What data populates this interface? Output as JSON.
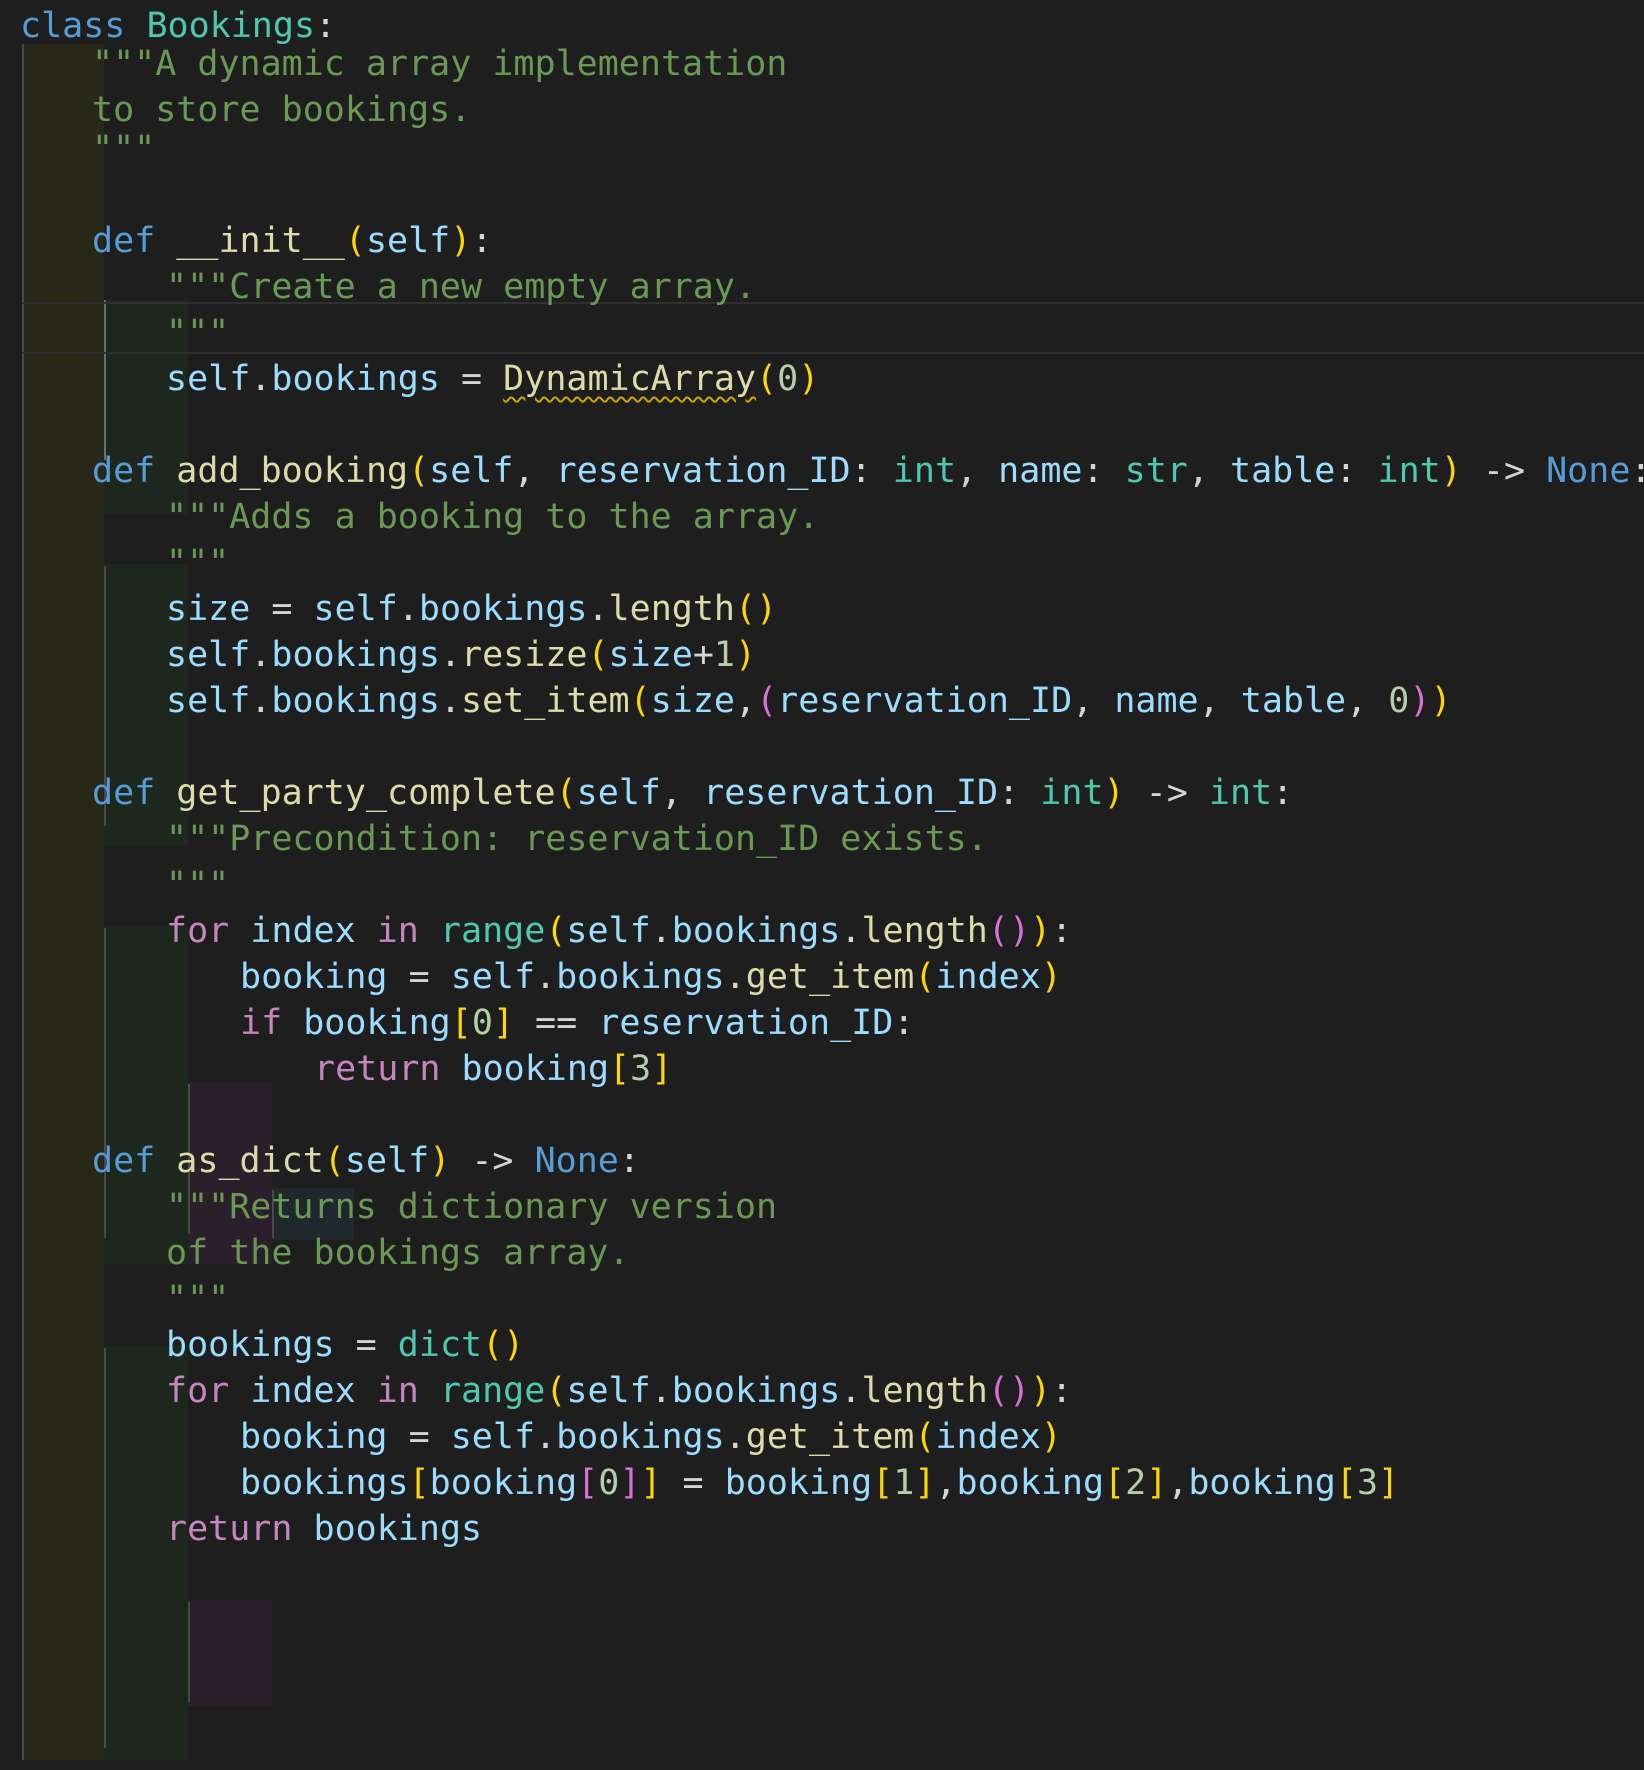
{
  "editor": {
    "language": "python",
    "colors": {
      "background": "#1e1e1e",
      "keyword": "#569cd6",
      "control": "#c586c0",
      "class_name": "#4ec9b0",
      "function": "#dcdcaa",
      "variable": "#9cdcfe",
      "string": "#6a9955",
      "number": "#b5cea8",
      "bracket_gold": "#ffd700",
      "bracket_purple": "#da70d6",
      "bracket_blue": "#179fff",
      "default": "#d4d4d4",
      "warning_squiggle": "#cca700"
    },
    "lines": [
      [
        [
          "class",
          "kw"
        ],
        [
          " ",
          "d"
        ],
        [
          "Bookings",
          "cls"
        ],
        [
          ":",
          "d"
        ]
      ],
      [
        [
          "\"\"\"A dynamic array implementation",
          "str"
        ]
      ],
      [
        [
          "to store bookings.",
          "str"
        ]
      ],
      [
        [
          "\"\"\"",
          "str"
        ]
      ],
      [],
      [
        [
          "def",
          "kw"
        ],
        [
          " ",
          "d"
        ],
        [
          "__init__",
          "fn"
        ],
        [
          "(",
          "b1"
        ],
        [
          "self",
          "var"
        ],
        [
          ")",
          "b1"
        ],
        [
          ":",
          "d"
        ]
      ],
      [
        [
          "\"\"\"Create a new empty array.",
          "str"
        ]
      ],
      [
        [
          "\"\"\"",
          "str"
        ]
      ],
      [
        [
          "self",
          "var"
        ],
        [
          ".",
          "d"
        ],
        [
          "bookings",
          "var"
        ],
        [
          " = ",
          "d"
        ],
        [
          "DynamicArray",
          "fnwarn"
        ],
        [
          "(",
          "b1"
        ],
        [
          "0",
          "num"
        ],
        [
          ")",
          "b1"
        ]
      ],
      [],
      [
        [
          "def",
          "kw"
        ],
        [
          " ",
          "d"
        ],
        [
          "add_booking",
          "fn"
        ],
        [
          "(",
          "b1"
        ],
        [
          "self",
          "var"
        ],
        [
          ", ",
          "d"
        ],
        [
          "reservation_ID",
          "var"
        ],
        [
          ": ",
          "d"
        ],
        [
          "int",
          "cls"
        ],
        [
          ", ",
          "d"
        ],
        [
          "name",
          "var"
        ],
        [
          ": ",
          "d"
        ],
        [
          "str",
          "cls"
        ],
        [
          ", ",
          "d"
        ],
        [
          "table",
          "var"
        ],
        [
          ": ",
          "d"
        ],
        [
          "int",
          "cls"
        ],
        [
          ")",
          "b1"
        ],
        [
          " -> ",
          "d"
        ],
        [
          "None",
          "kw"
        ],
        [
          ":",
          "d"
        ]
      ],
      [
        [
          "\"\"\"Adds a booking to the array.",
          "str"
        ]
      ],
      [
        [
          "\"\"\"",
          "str"
        ]
      ],
      [
        [
          "size",
          "var"
        ],
        [
          " = ",
          "d"
        ],
        [
          "self",
          "var"
        ],
        [
          ".",
          "d"
        ],
        [
          "bookings",
          "var"
        ],
        [
          ".",
          "d"
        ],
        [
          "length",
          "fn"
        ],
        [
          "()",
          "b1"
        ]
      ],
      [
        [
          "self",
          "var"
        ],
        [
          ".",
          "d"
        ],
        [
          "bookings",
          "var"
        ],
        [
          ".",
          "d"
        ],
        [
          "resize",
          "fn"
        ],
        [
          "(",
          "b1"
        ],
        [
          "size",
          "var"
        ],
        [
          "+",
          "d"
        ],
        [
          "1",
          "num"
        ],
        [
          ")",
          "b1"
        ]
      ],
      [
        [
          "self",
          "var"
        ],
        [
          ".",
          "d"
        ],
        [
          "bookings",
          "var"
        ],
        [
          ".",
          "d"
        ],
        [
          "set_item",
          "fn"
        ],
        [
          "(",
          "b1"
        ],
        [
          "size",
          "var"
        ],
        [
          ",",
          "d"
        ],
        [
          "(",
          "b2"
        ],
        [
          "reservation_ID",
          "var"
        ],
        [
          ", ",
          "d"
        ],
        [
          "name",
          "var"
        ],
        [
          ", ",
          "d"
        ],
        [
          "table",
          "var"
        ],
        [
          ", ",
          "d"
        ],
        [
          "0",
          "num"
        ],
        [
          ")",
          "b2"
        ],
        [
          ")",
          "b1"
        ]
      ],
      [],
      [
        [
          "def",
          "kw"
        ],
        [
          " ",
          "d"
        ],
        [
          "get_party_complete",
          "fn"
        ],
        [
          "(",
          "b1"
        ],
        [
          "self",
          "var"
        ],
        [
          ", ",
          "d"
        ],
        [
          "reservation_ID",
          "var"
        ],
        [
          ": ",
          "d"
        ],
        [
          "int",
          "cls"
        ],
        [
          ")",
          "b1"
        ],
        [
          " -> ",
          "d"
        ],
        [
          "int",
          "cls"
        ],
        [
          ":",
          "d"
        ]
      ],
      [
        [
          "\"\"\"Precondition: reservation_ID exists.",
          "str"
        ]
      ],
      [
        [
          "\"\"\"",
          "str"
        ]
      ],
      [
        [
          "for",
          "ctl"
        ],
        [
          " ",
          "d"
        ],
        [
          "index",
          "var"
        ],
        [
          " ",
          "d"
        ],
        [
          "in",
          "ctl"
        ],
        [
          " ",
          "d"
        ],
        [
          "range",
          "cls"
        ],
        [
          "(",
          "b1"
        ],
        [
          "self",
          "var"
        ],
        [
          ".",
          "d"
        ],
        [
          "bookings",
          "var"
        ],
        [
          ".",
          "d"
        ],
        [
          "length",
          "fn"
        ],
        [
          "()",
          "b2"
        ],
        [
          ")",
          "b1"
        ],
        [
          ":",
          "d"
        ]
      ],
      [
        [
          "booking",
          "var"
        ],
        [
          " = ",
          "d"
        ],
        [
          "self",
          "var"
        ],
        [
          ".",
          "d"
        ],
        [
          "bookings",
          "var"
        ],
        [
          ".",
          "d"
        ],
        [
          "get_item",
          "fn"
        ],
        [
          "(",
          "b1"
        ],
        [
          "index",
          "var"
        ],
        [
          ")",
          "b1"
        ]
      ],
      [
        [
          "if",
          "ctl"
        ],
        [
          " ",
          "d"
        ],
        [
          "booking",
          "var"
        ],
        [
          "[",
          "b1"
        ],
        [
          "0",
          "num"
        ],
        [
          "]",
          "b1"
        ],
        [
          " == ",
          "d"
        ],
        [
          "reservation_ID",
          "var"
        ],
        [
          ":",
          "d"
        ]
      ],
      [
        [
          "return",
          "ctl"
        ],
        [
          " ",
          "d"
        ],
        [
          "booking",
          "var"
        ],
        [
          "[",
          "b1"
        ],
        [
          "3",
          "num"
        ],
        [
          "]",
          "b1"
        ]
      ],
      [],
      [
        [
          "def",
          "kw"
        ],
        [
          " ",
          "d"
        ],
        [
          "as_dict",
          "fn"
        ],
        [
          "(",
          "b1"
        ],
        [
          "self",
          "var"
        ],
        [
          ")",
          "b1"
        ],
        [
          " -> ",
          "d"
        ],
        [
          "None",
          "kw"
        ],
        [
          ":",
          "d"
        ]
      ],
      [
        [
          "\"\"\"Returns dictionary version",
          "str"
        ]
      ],
      [
        [
          "of the bookings array.",
          "str"
        ]
      ],
      [
        [
          "\"\"\"",
          "str"
        ]
      ],
      [
        [
          "bookings",
          "var"
        ],
        [
          " = ",
          "d"
        ],
        [
          "dict",
          "cls"
        ],
        [
          "()",
          "b1"
        ]
      ],
      [
        [
          "for",
          "ctl"
        ],
        [
          " ",
          "d"
        ],
        [
          "index",
          "var"
        ],
        [
          " ",
          "d"
        ],
        [
          "in",
          "ctl"
        ],
        [
          " ",
          "d"
        ],
        [
          "range",
          "cls"
        ],
        [
          "(",
          "b1"
        ],
        [
          "self",
          "var"
        ],
        [
          ".",
          "d"
        ],
        [
          "bookings",
          "var"
        ],
        [
          ".",
          "d"
        ],
        [
          "length",
          "fn"
        ],
        [
          "()",
          "b2"
        ],
        [
          ")",
          "b1"
        ],
        [
          ":",
          "d"
        ]
      ],
      [
        [
          "booking",
          "var"
        ],
        [
          " = ",
          "d"
        ],
        [
          "self",
          "var"
        ],
        [
          ".",
          "d"
        ],
        [
          "bookings",
          "var"
        ],
        [
          ".",
          "d"
        ],
        [
          "get_item",
          "fn"
        ],
        [
          "(",
          "b1"
        ],
        [
          "index",
          "var"
        ],
        [
          ")",
          "b1"
        ]
      ],
      [
        [
          "bookings",
          "var"
        ],
        [
          "[",
          "b1"
        ],
        [
          "booking",
          "var"
        ],
        [
          "[",
          "b2"
        ],
        [
          "0",
          "num"
        ],
        [
          "]",
          "b2"
        ],
        [
          "]",
          "b1"
        ],
        [
          " = ",
          "d"
        ],
        [
          "booking",
          "var"
        ],
        [
          "[",
          "b1"
        ],
        [
          "1",
          "num"
        ],
        [
          "]",
          "b1"
        ],
        [
          ",",
          "d"
        ],
        [
          "booking",
          "var"
        ],
        [
          "[",
          "b1"
        ],
        [
          "2",
          "num"
        ],
        [
          "]",
          "b1"
        ],
        [
          ",",
          "d"
        ],
        [
          "booking",
          "var"
        ],
        [
          "[",
          "b1"
        ],
        [
          "3",
          "num"
        ],
        [
          "]",
          "b1"
        ]
      ],
      [
        [
          "return",
          "ctl"
        ],
        [
          " ",
          "d"
        ],
        [
          "bookings",
          "var"
        ]
      ]
    ]
  }
}
